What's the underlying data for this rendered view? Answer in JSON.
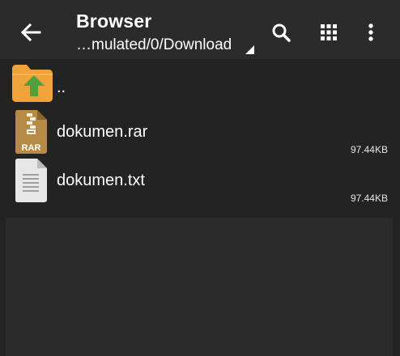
{
  "app": {
    "title": "Browser",
    "path": "…mulated/0/Download"
  },
  "toolbar": {
    "icons": {
      "back": "arrow-back-icon",
      "search": "search-icon",
      "grid": "grid-view-icon",
      "more": "more-vert-icon"
    }
  },
  "files": [
    {
      "name": "..",
      "size": "",
      "icon": "folder-up-icon"
    },
    {
      "name": "dokumen.rar",
      "size": "97.44KB",
      "icon": "rar-archive-icon",
      "icon_label": "RAR"
    },
    {
      "name": "dokumen.txt",
      "size": "97.44KB",
      "icon": "text-document-icon"
    }
  ],
  "colors": {
    "background": "#232323",
    "toolbar": "#2b2b2b",
    "folder": "#f1a33b",
    "folder_arrow": "#4ea23c",
    "archive": "#b78b46",
    "document": "#e7e7e7",
    "empty_pane": "#2a2a2a"
  }
}
